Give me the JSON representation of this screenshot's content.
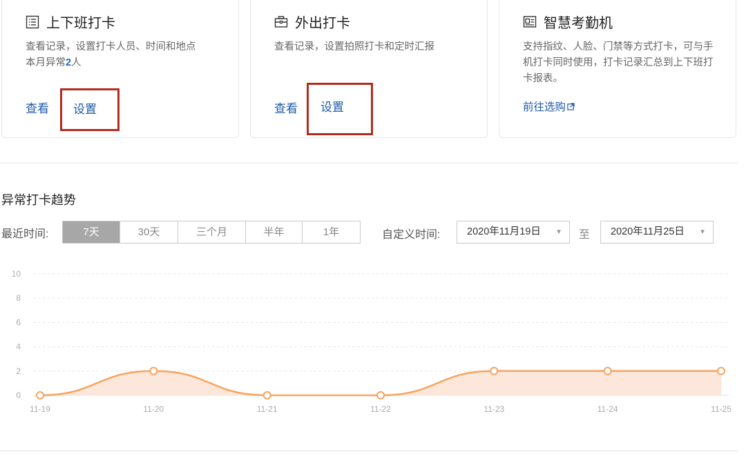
{
  "cards": [
    {
      "title": "上下班打卡",
      "desc1": "查看记录，设置打卡人员、时间和地点",
      "desc2_prefix": "本月异常",
      "desc2_count": "2",
      "desc2_suffix": "人",
      "link_view": "查看",
      "link_set": "设置"
    },
    {
      "title": "外出打卡",
      "desc1": "查看记录，设置拍照打卡和定时汇报",
      "link_view": "查看",
      "link_set": "设置"
    },
    {
      "title": "智慧考勤机",
      "desc1": "支持指纹、人脸、门禁等方式打卡，可与手机打卡同时使用，打卡记录汇总到上下班打卡报表。",
      "link_buy": "前往选购"
    }
  ],
  "icons": {
    "card1": "list-icon",
    "card2": "briefcase-icon",
    "card3": "attendance-machine-icon",
    "external": "external-link-icon"
  },
  "trend": {
    "title": "异常打卡趋势",
    "recent_label": "最近时间:",
    "ranges": [
      "7天",
      "30天",
      "三个月",
      "半年",
      "1年"
    ],
    "active_range": "7天",
    "custom_label": "自定义时间:",
    "date_start": "2020年11月19日",
    "date_to": "至",
    "date_end": "2020年11月25日"
  },
  "colors": {
    "accent_line": "#f9a25c",
    "area_fill": "#fde3d3",
    "highlight_box": "#b52a1c",
    "link": "#1d5aa8"
  },
  "chart_data": {
    "type": "area",
    "categories": [
      "11-19",
      "11-20",
      "11-21",
      "11-22",
      "11-23",
      "11-24",
      "11-25"
    ],
    "values": [
      0,
      2,
      0,
      0,
      2,
      2,
      2
    ],
    "ylim": [
      0,
      10
    ],
    "yticks": [
      0,
      2,
      4,
      6,
      8,
      10
    ],
    "grid": true
  }
}
